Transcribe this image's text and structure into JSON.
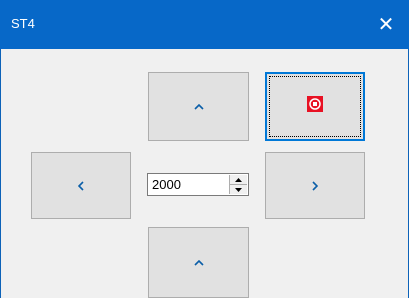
{
  "window": {
    "title": "ST4",
    "close_glyph": "✕",
    "titlebar_color": "#0768c8",
    "accent_color": "#0078d7",
    "stop_icon_color": "#e81123"
  },
  "controls": {
    "up_top": {
      "icon": "chevron-up-icon"
    },
    "stop": {
      "icon": "stop-record-icon"
    },
    "left": {
      "icon": "chevron-left-icon"
    },
    "right": {
      "icon": "chevron-right-icon"
    },
    "up_bottom": {
      "icon": "chevron-up-icon"
    },
    "value_spinner": {
      "value": "2000"
    }
  }
}
